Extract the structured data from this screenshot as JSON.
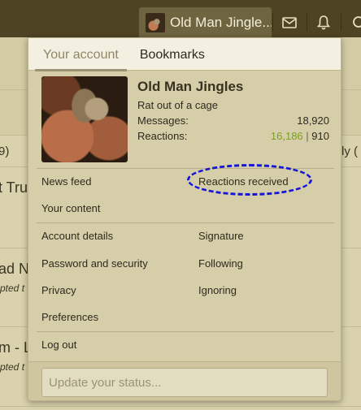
{
  "topbar": {
    "username": "Old Man Jingle...",
    "icons": [
      "mail-icon",
      "bell-icon",
      "search-icon"
    ]
  },
  "background": {
    "fragments": [
      "9)",
      "ly (",
      "t Tru",
      "ad N",
      "pted t",
      "m - L",
      "pted t"
    ]
  },
  "menu": {
    "tabs": [
      {
        "label": "Your account",
        "active": true
      },
      {
        "label": "Bookmarks",
        "active": false
      }
    ],
    "profile": {
      "name": "Old Man Jingles",
      "user_title": "Rat out of a cage",
      "messages_label": "Messages:",
      "messages_value": "18,920",
      "reactions_label": "Reactions:",
      "reactions_positive": "16,186",
      "reactions_separator": "|",
      "reactions_other": "910"
    },
    "links_group1": {
      "news_feed": "News feed",
      "reactions_received": "Reactions received",
      "your_content": "Your content"
    },
    "links_group2": {
      "account_details": "Account details",
      "signature": "Signature",
      "password_security": "Password and security",
      "following": "Following",
      "privacy": "Privacy",
      "ignoring": "Ignoring",
      "preferences": "Preferences"
    },
    "logout": "Log out",
    "status_placeholder": "Update your status..."
  },
  "colors": {
    "topbar": "#4e4424",
    "menu_bg": "#d6cea9",
    "positive_reactions": "#79a11f",
    "annotation_ring": "#1515d8"
  }
}
